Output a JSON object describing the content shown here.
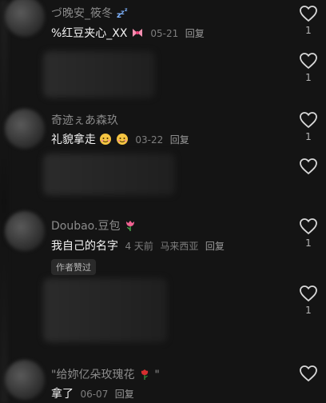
{
  "comments": [
    {
      "username": "づ晚安_筱冬",
      "text": "%红豆夹心_XX",
      "date": "05-21",
      "reply": "回复",
      "likes": "1"
    },
    {
      "likes": "1"
    },
    {
      "username": "奇迹ぇあ森玖",
      "text": "礼貌拿走",
      "date": "03-22",
      "reply": "回复",
      "likes": "1"
    },
    {
      "likes": ""
    },
    {
      "username": "Doubao.豆包",
      "text": "我自己的名字",
      "date": "4 天前",
      "location": "马来西亚",
      "reply": "回复",
      "badge": "作者赞过",
      "likes": "1"
    },
    {
      "likes": "1"
    },
    {
      "username": "\"给妳亿朵玫瑰花",
      "username_suffix": "\"",
      "text": "拿了",
      "date": "06-07",
      "reply": "回复",
      "likes": ""
    }
  ],
  "icons": {
    "heart": "heart-outline-icon",
    "zzz": "sleep-zzz-icon",
    "bow": "pink-bow-icon",
    "face": "smiling-face-icon",
    "tulip": "tulip-icon",
    "rose": "rose-icon"
  },
  "colors": {
    "background": "#141414",
    "username": "#8b8b8b",
    "text": "#f2f2f2",
    "meta": "#7e7e7e"
  }
}
